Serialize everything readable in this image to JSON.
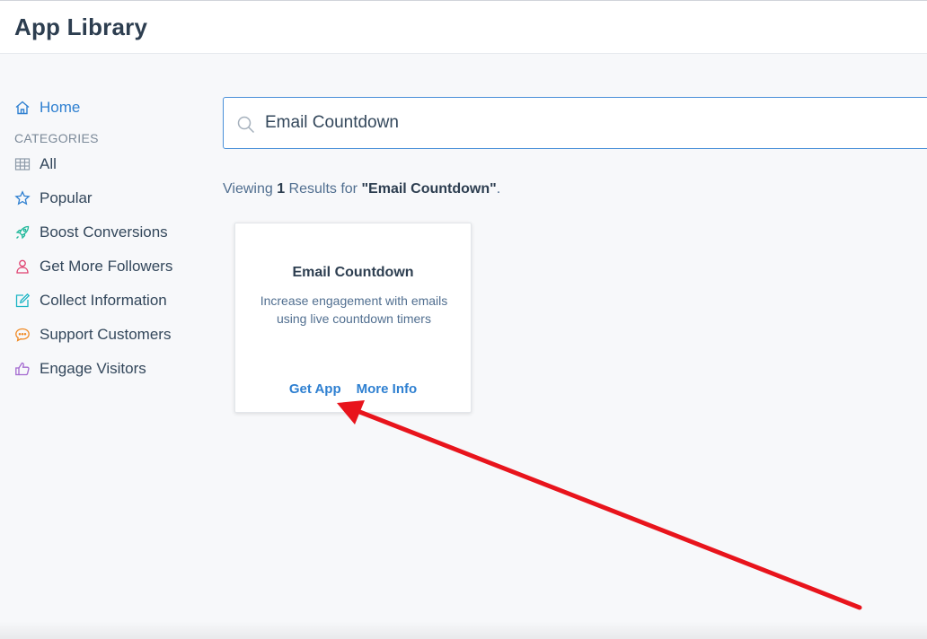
{
  "header": {
    "title": "App Library"
  },
  "sidebar": {
    "home_label": "Home",
    "categories_label": "CATEGORIES",
    "items": [
      {
        "label": "All",
        "icon": "grid-icon"
      },
      {
        "label": "Popular",
        "icon": "star-icon"
      },
      {
        "label": "Boost Conversions",
        "icon": "rocket-icon"
      },
      {
        "label": "Get More Followers",
        "icon": "person-icon"
      },
      {
        "label": "Collect Information",
        "icon": "edit-icon"
      },
      {
        "label": "Support Customers",
        "icon": "chat-bubble-icon"
      },
      {
        "label": "Engage Visitors",
        "icon": "thumbs-up-icon"
      }
    ]
  },
  "search": {
    "value": "Email Countdown"
  },
  "results": {
    "prefix": "Viewing ",
    "count": "1",
    "middle": " Results for ",
    "query": "\"Email Countdown\"",
    "suffix": "."
  },
  "card": {
    "title": "Email Countdown",
    "description": "Increase engagement with emails using live countdown timers",
    "get_app_label": "Get App",
    "more_info_label": "More Info"
  },
  "colors": {
    "accent": "#2f80d1",
    "arrow": "#e8141c",
    "heading": "#2d3e50",
    "rocket": "#1fb89a",
    "person": "#e0406f",
    "edit": "#1cb5c4",
    "chat": "#f08a24",
    "thumbs": "#a46ad0"
  }
}
